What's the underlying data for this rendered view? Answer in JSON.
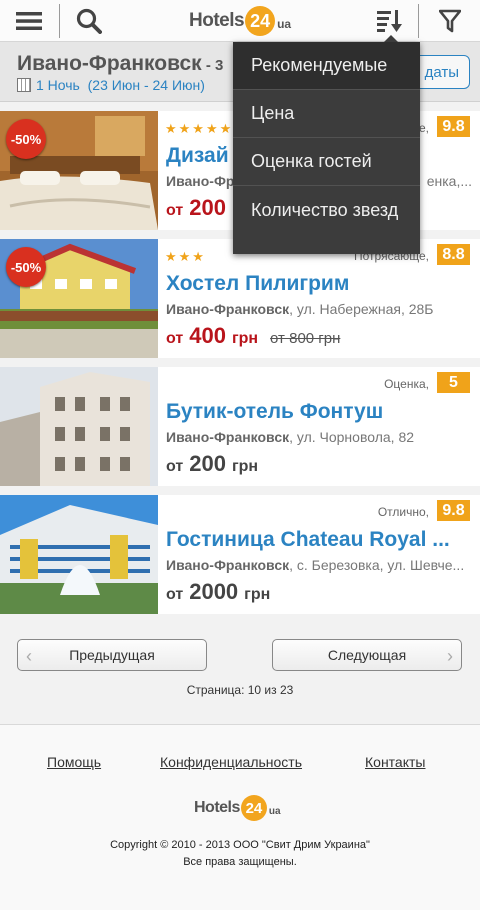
{
  "brand": {
    "name": "Hotels",
    "badge": "24",
    "suffix": "ua"
  },
  "header": {
    "city": "Ивано-Франковск",
    "city_suffix": " - 3",
    "nights": "1 Ночь",
    "range": "(23 Июн - 24 Июн)",
    "dates_button": "ь даты"
  },
  "sort_menu": {
    "items": [
      "Рекомендуемые",
      "Цена",
      "Оценка гостей",
      "Количество звезд"
    ]
  },
  "hotels": [
    {
      "discount": "-50%",
      "stars": "★★★★★",
      "rating_word": "e,",
      "score": "9.8",
      "name": "Дизай",
      "city": "Ивано-Фр",
      "address": "енка,...",
      "from": "от",
      "price": "200",
      "currency": "",
      "old_price": ""
    },
    {
      "discount": "-50%",
      "stars": "★★★",
      "rating_word": "Потрясающе,",
      "score": "8.8",
      "name": "Хостел Пилигрим",
      "city": "Ивано-Франковск",
      "address": ", ул. Набережная, 28Б",
      "from": "от",
      "price": "400",
      "currency": "грн",
      "old_price": "от 800 грн"
    },
    {
      "discount": "",
      "stars": "",
      "rating_word": "Оценка,",
      "score": "5",
      "name": "Бутик-отель Фонтуш",
      "city": "Ивано-Франковск",
      "address": ", ул. Чорновола, 82",
      "from": "от",
      "price": "200",
      "currency": "грн",
      "old_price": ""
    },
    {
      "discount": "",
      "stars": "",
      "rating_word": "Отлично,",
      "score": "9.8",
      "name": "Гостиница Chateau Royal ...",
      "city": "Ивано-Франковск",
      "address": ", с. Березовка, ул. Шевче...",
      "from": "от",
      "price": "2000",
      "currency": "грн",
      "old_price": ""
    }
  ],
  "pager": {
    "prev": "Предыдущая",
    "next": "Следующая",
    "info": "Страница: 10 из 23"
  },
  "footer": {
    "links": [
      "Помощь",
      "Конфиденциальность",
      "Контакты"
    ],
    "copyright": "Copyright © 2010 - 2013 ООО \"Свит Дрим Украина\"",
    "rights": "Все права защищены."
  },
  "icons": {
    "menu": "hamburger-icon",
    "search": "search-icon",
    "sort": "sort-icon",
    "filter": "filter-icon",
    "calendar": "calendar-icon"
  },
  "colors": {
    "accent": "#2b83c2",
    "badge": "#f0a31a",
    "sale": "#d9301f",
    "price_red": "#b9141b"
  }
}
